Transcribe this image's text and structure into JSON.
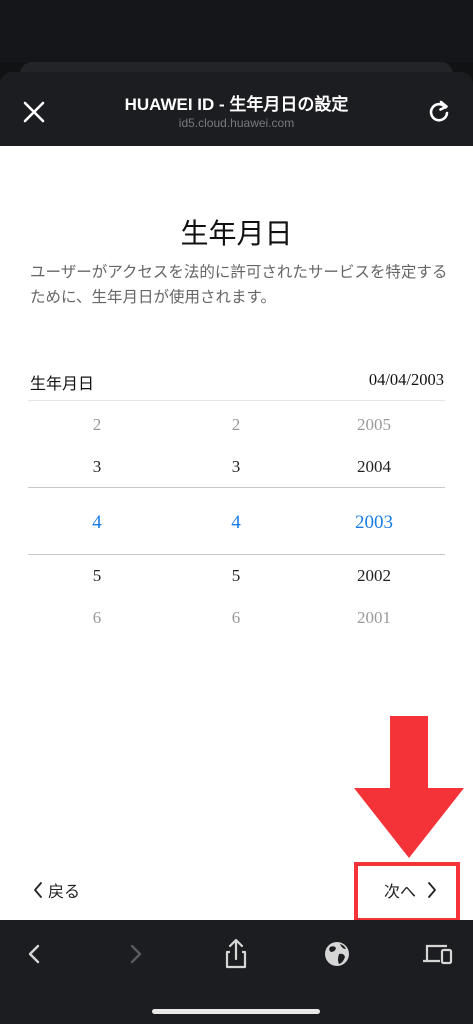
{
  "header": {
    "title": "HUAWEI ID - 生年月日の設定",
    "url": "id5.cloud.huawei.com"
  },
  "page": {
    "title": "生年月日",
    "description": "ユーザーがアクセスを法的に許可されたサービスを特定するために、生年月日が使用されます。",
    "dob_label": "生年月日",
    "dob_value": "04/04/2003"
  },
  "picker": {
    "month": [
      "2",
      "3",
      "4",
      "5",
      "6"
    ],
    "day": [
      "2",
      "3",
      "4",
      "5",
      "6"
    ],
    "year": [
      "2005",
      "2004",
      "2003",
      "2002",
      "2001"
    ],
    "selected_index": 2,
    "accent_color": "#1a7ce6"
  },
  "footer": {
    "back_label": "戻る",
    "next_label": "次へ"
  },
  "annotation": {
    "color": "#f43339",
    "arrow_icon": "down-arrow-icon"
  },
  "toolbar": {
    "items": [
      "back-icon",
      "forward-icon",
      "share-icon",
      "globe-icon",
      "devices-icon"
    ]
  }
}
